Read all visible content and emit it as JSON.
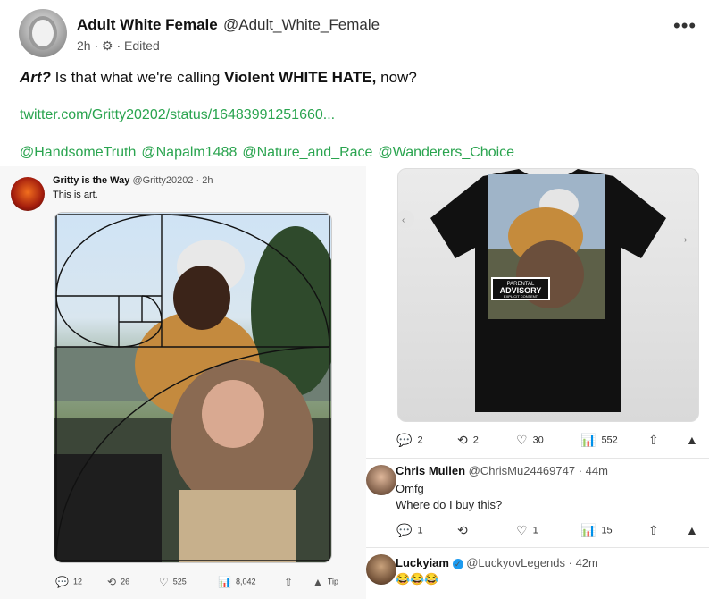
{
  "post": {
    "author_name": "Adult White Female",
    "author_handle": "@Adult_White_Female",
    "time": "2h",
    "edited": "Edited",
    "more": "•••",
    "text_art": "Art?",
    "text_mid": " Is that what we're calling ",
    "text_bold": "Violent WHITE HATE,",
    "text_end": " now?",
    "link": "twitter.com/Gritty20202/status/16483991251660...",
    "mentions": [
      "@HandsomeTruth",
      "@Napalm1488",
      "@Nature_and_Race",
      "@Wanderers_Choice"
    ]
  },
  "left_embed": {
    "name": "Gritty is the Way",
    "handle": "@Gritty20202",
    "time": "· 2h",
    "text": "This is art.",
    "actions": {
      "replies": "12",
      "retweets": "26",
      "likes": "525",
      "views": "8,042",
      "tip": "Tip"
    }
  },
  "right_embed": {
    "shirt_label_line1": "PARENTAL",
    "shirt_label_line2": "ADVISORY",
    "shirt_label_line3": "EXPLICIT CONTENT",
    "actions": {
      "replies": "2",
      "retweets": "2",
      "likes": "30",
      "views": "552"
    }
  },
  "replies": [
    {
      "name": "Chris Mullen",
      "handle": "@ChrisMu24469747",
      "time": "· 44m",
      "line1": "Omfg",
      "line2": "Where do I buy this?",
      "actions": {
        "replies": "1",
        "retweets": "",
        "likes": "1",
        "views": "15"
      }
    },
    {
      "name": "Luckyiam",
      "handle": "@LuckyovLegends",
      "time": "· 42m",
      "line1": "😂😂😂"
    }
  ],
  "icons": {
    "reply": "💬",
    "retweet": "⟲",
    "like": "♡",
    "views": "📊",
    "share": "⇧",
    "tip": "▲"
  }
}
